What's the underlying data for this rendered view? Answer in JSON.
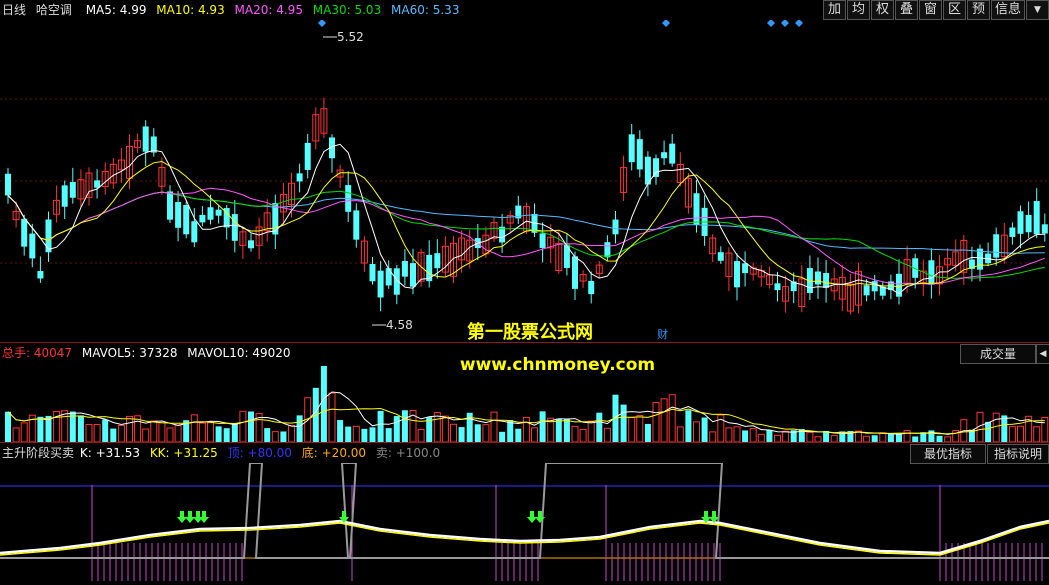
{
  "main_header": {
    "period_label": "日线",
    "stock_name": "哈空调",
    "ma": [
      {
        "label": "MA5: 4.99",
        "color": "#ffffff"
      },
      {
        "label": "MA10: 4.93",
        "color": "#ffff00"
      },
      {
        "label": "MA20: 4.95",
        "color": "#ff55ff"
      },
      {
        "label": "MA30: 5.03",
        "color": "#00dd00"
      },
      {
        "label": "MA60: 5.33",
        "color": "#55bbff"
      }
    ]
  },
  "toolbar": [
    "加",
    "均",
    "权",
    "叠",
    "窗",
    "区",
    "预",
    "信息",
    "▼"
  ],
  "price_high_label": "5.52",
  "price_low_label": "4.58",
  "finance_marker": "财",
  "watermark": {
    "title": "第一股票公式网",
    "url": "www.chnmoney.com"
  },
  "volume_header": {
    "total_label": "总手: 40047",
    "mavol5": "MAVOL5: 37328",
    "mavol10": "MAVOL10: 49020",
    "indicator_button": "成交量",
    "arrow_button": "◀"
  },
  "indicator_header": {
    "name": "主升阶段买卖",
    "k": "K: +31.53",
    "kk": "KK: +31.25",
    "top": "顶: +80.00",
    "bottom": "底: +20.00",
    "sell": "卖: +100.0",
    "optimize_button": "最优指标",
    "help_button": "指标说明"
  },
  "colors": {
    "up": "#ff3333",
    "down": "#55ffff",
    "ma5": "#ffffff",
    "ma10": "#ffff00",
    "ma20": "#ff55ff",
    "ma30": "#00dd00",
    "ma60": "#55bbff",
    "top_line": "#3333ff",
    "bottom_line": "#ffaa00",
    "signal_bars": "#cc44cc",
    "buy_arrow": "#33ff33"
  }
}
